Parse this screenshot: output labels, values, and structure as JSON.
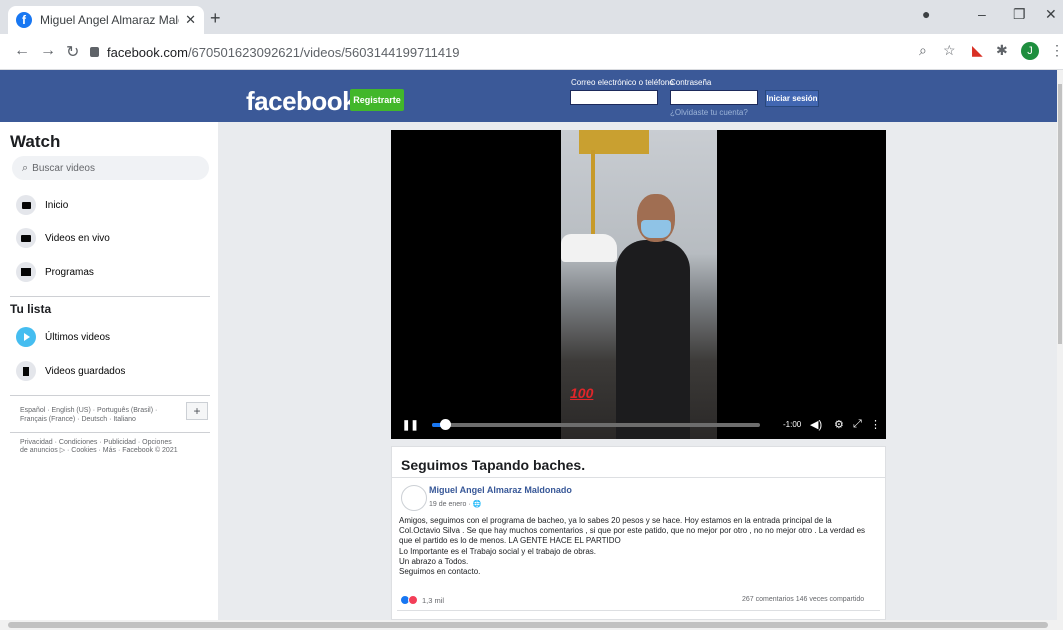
{
  "browser": {
    "tab_title": "Miguel Angel Almaraz Maldonado",
    "url_host": "facebook.com",
    "url_path": "/670501623092621/videos/5603144199711419",
    "profile_initial": "J"
  },
  "fb_header": {
    "logo": "facebook",
    "register": "Registrarte",
    "email_label": "Correo electrónico o teléfono",
    "password_label": "Contraseña",
    "login": "Iniciar sesión",
    "forgot": "¿Olvidaste tu cuenta?"
  },
  "sidebar": {
    "title": "Watch",
    "search_placeholder": "Buscar videos",
    "items": [
      "Inicio",
      "Videos en vivo",
      "Programas"
    ],
    "list_title": "Tu lista",
    "list_items": [
      "Últimos videos",
      "Videos guardados"
    ],
    "languages": "Español · English (US) · Português (Brasil) · Français (France) · Deutsch · Italiano",
    "footer": "Privacidad · Condiciones · Publicidad · Opciones de anuncios ▷ · Cookies · Más · Facebook © 2021"
  },
  "video": {
    "time": "-1:00",
    "progress": 0.04,
    "overlay_emoji": "💯"
  },
  "post": {
    "title": "Seguimos Tapando baches.",
    "author": "Miguel Angel Almaraz Maldonado",
    "date": "19 de enero ·",
    "body_lines": [
      "Amigos, seguimos con el programa de bacheo, ya lo sabes 20 pesos y se hace. Hoy estamos en la entrada principal de la",
      "Col.Octavio Silva . Se que hay muchos comentarios , si que por este patido, que no mejor por otro , no no mejor otro . La verdad es",
      "que el partido es lo de menos. LA GENTE HACE EL PARTIDO",
      "Lo Importante es el Trabajo social y el trabajo de obras.",
      "Un abrazo a Todos.",
      "Seguimos en contacto."
    ],
    "reactions_count": "1,3 mil",
    "stats": "267 comentarios  146 veces compartido"
  },
  "colors": {
    "fb_blue": "#3b5998",
    "register_green": "#42b72a",
    "progress_blue": "#1877f2"
  }
}
